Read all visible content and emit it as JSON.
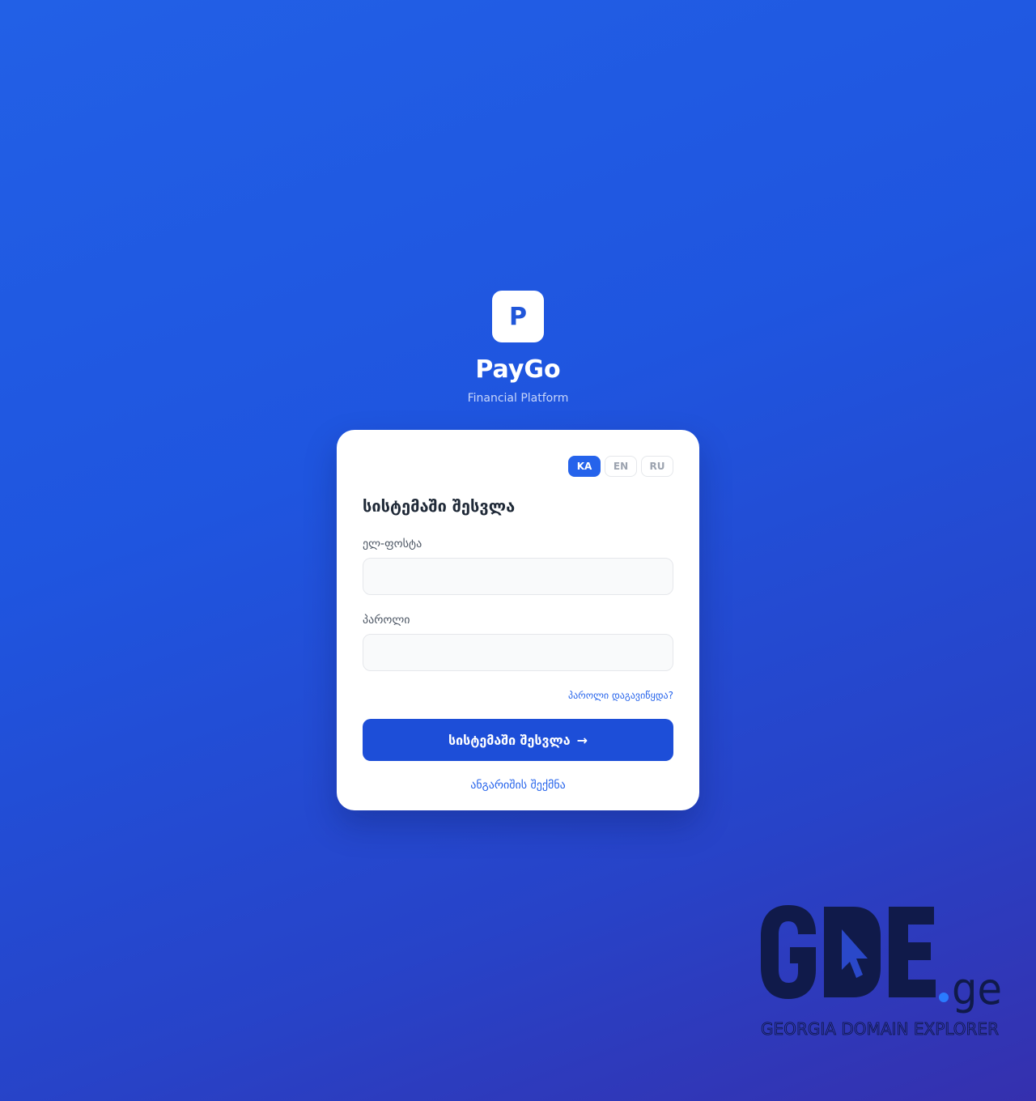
{
  "brand": {
    "logo_letter": "P",
    "name": "PayGo",
    "subtitle": "Financial Platform"
  },
  "languages": [
    {
      "code": "KA",
      "active": true
    },
    {
      "code": "EN",
      "active": false
    },
    {
      "code": "RU",
      "active": false
    }
  ],
  "login": {
    "title": "სისტემაში შესვლა",
    "email_label": "ელ-ფოსტა",
    "email_value": "",
    "password_label": "პაროლი",
    "password_value": "",
    "forgot_link": "პაროლი დაგავიწყდა?",
    "submit_label": "სისტემაში შესვლა",
    "submit_icon": "→",
    "register_link": "ანგარიშის შექმნა"
  },
  "watermark": {
    "logo_text": "GDE.ge",
    "tagline": "GEORGIA DOMAIN EXPLORER"
  },
  "colors": {
    "accent": "#2563eb",
    "button": "#1d4ed8",
    "background_start": "#2260e6",
    "background_end": "#3530ae"
  }
}
